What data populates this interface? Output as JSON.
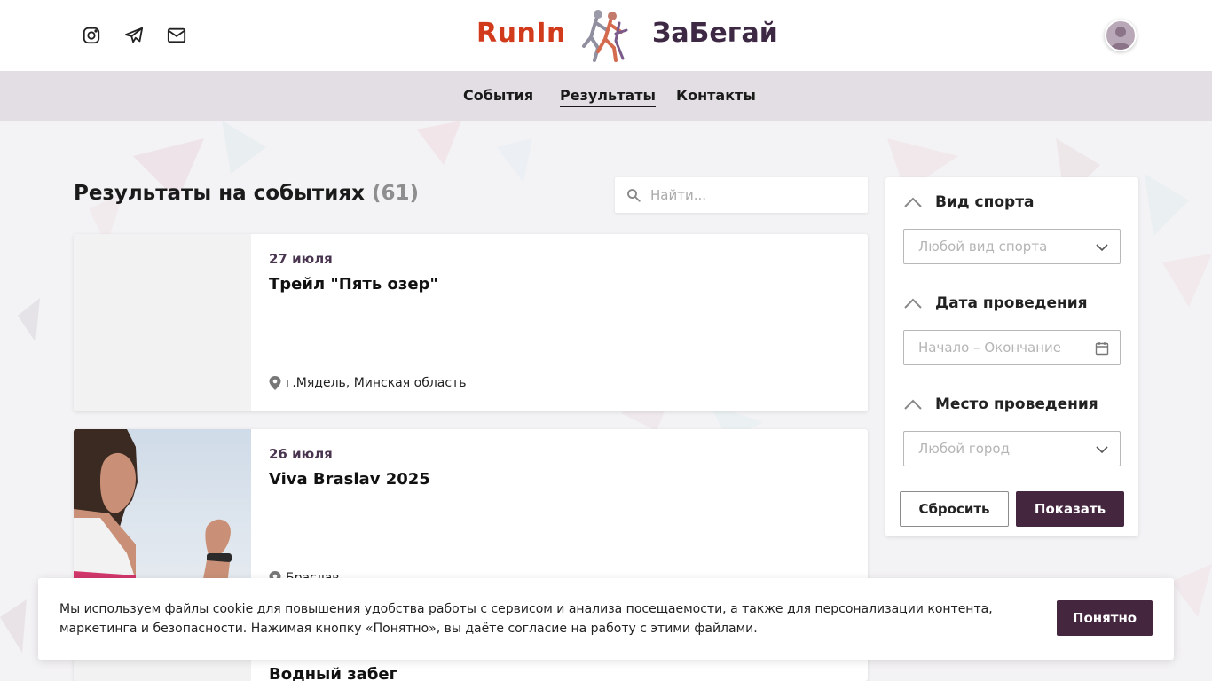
{
  "header": {
    "brand_left": "RunIn",
    "brand_right": "ЗаБегай",
    "social": [
      {
        "icon": "instagram-icon"
      },
      {
        "icon": "telegram-icon"
      },
      {
        "icon": "mail-icon"
      }
    ],
    "avatar_icon": "user-avatar-icon"
  },
  "nav": {
    "items": [
      {
        "label": "События"
      },
      {
        "label": "Результаты"
      },
      {
        "label": "Контакты"
      }
    ],
    "active": "Результаты"
  },
  "main": {
    "title": "Результаты на событиях",
    "count": "(61)",
    "search_placeholder": "Найти..."
  },
  "events": [
    {
      "date": "27 июля",
      "name": "Трейл \"Пять озер\"",
      "place": "г.Мядель, Минская область"
    },
    {
      "date": "26 июля",
      "name": "Viva Braslav 2025",
      "place": "Браслав"
    },
    {
      "name": "Водный забег"
    }
  ],
  "filters": {
    "sport": {
      "label": "Вид спорта",
      "placeholder": "Любой вид спорта"
    },
    "date": {
      "label": "Дата проведения",
      "placeholder": "Начало – Окончание"
    },
    "place": {
      "label": "Место проведения",
      "placeholder": "Любой город"
    },
    "reset_label": "Сбросить",
    "show_label": "Показать"
  },
  "cookie": {
    "text": "Мы используем файлы cookie для повышения удобства работы с сервисом и анализа посещаемости, а также для персонализации контента, маркетинга и безопасности. Нажимая кнопку «Понятно», вы даёте согласие на работу с этими файлами.",
    "button_label": "Понятно"
  },
  "colors": {
    "brand_left": "#d13a1a",
    "brand_right": "#3e2945",
    "accent": "#45263f",
    "nav_bg": "#e2dee3"
  }
}
